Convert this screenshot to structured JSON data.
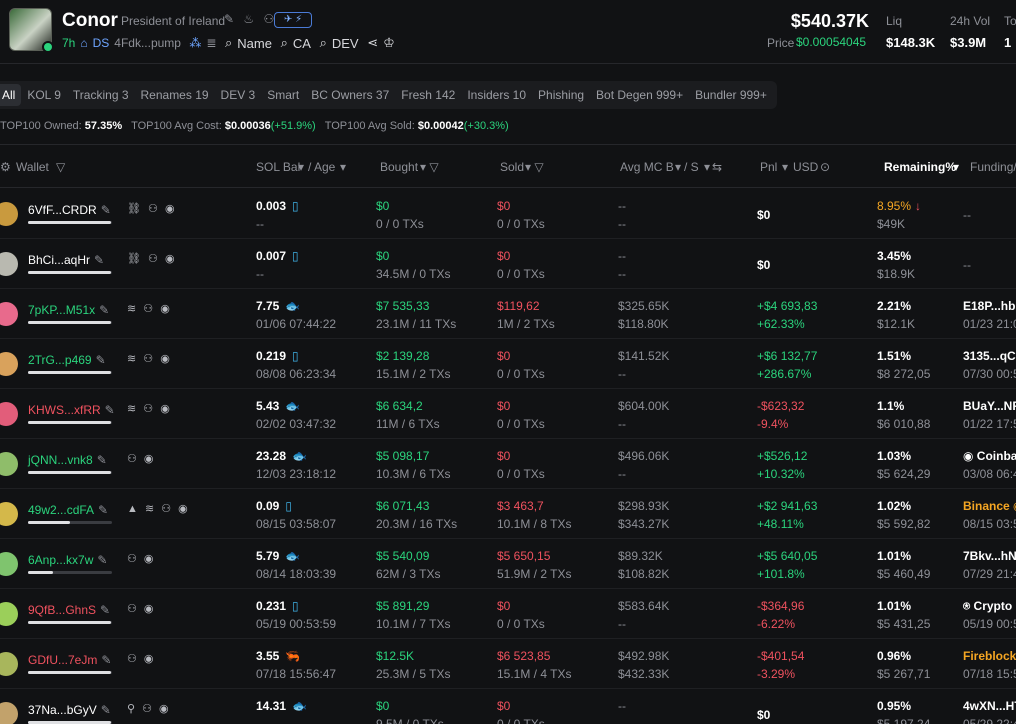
{
  "token": {
    "name": "Conor",
    "description": "President of Ireland",
    "social_badge": "✈ ⚡",
    "age": "7h",
    "dex": "DS",
    "contract_short": "4Fdk...pump",
    "search_name": "Name",
    "search_ca": "CA",
    "search_dev": "DEV",
    "market_cap": "$540.37K",
    "price_label": "Price",
    "price": "$0.00054045",
    "liq_label": "Liq",
    "liq": "$148.3K",
    "vol_label": "24h Vol",
    "vol": "$3.9M",
    "extra_label": "To",
    "extra_value": "1"
  },
  "tabs": [
    "All",
    "KOL 9",
    "Tracking 3",
    "Renames 19",
    "DEV 3",
    "Smart",
    "BC Owners 37",
    "Fresh 142",
    "Insiders 10",
    "Phishing",
    "Bot Degen 999+",
    "Bundler 999+"
  ],
  "top100": {
    "owned_label": "TOP100 Owned:",
    "owned": "57.35%",
    "avg_cost_label": "TOP100 Avg Cost:",
    "avg_cost": "$0.00036",
    "avg_cost_change": "(+51.9%)",
    "avg_sold_label": "TOP100 Avg Sold:",
    "avg_sold": "$0.00042",
    "avg_sold_change": "(+30.3%)"
  },
  "columns": {
    "wallet": "Wallet",
    "sol_bal": "SOL Bal",
    "age": "/ Age",
    "bought": "Bought",
    "sold": "Sold",
    "avg_mc": "Avg MC B",
    "avg_mc_s": "/ S",
    "pnl": "Pnl",
    "usd": "USD",
    "remaining": "Remaining%",
    "funding": "Funding/"
  },
  "rows": [
    {
      "addr": "6VfF...CRDR",
      "addr_color": "#ffffff",
      "tags": "⛓ ⚇ ◉",
      "bar": 0.99,
      "sol": "0.003",
      "sol_icon": "▯",
      "age": "--",
      "bought": "$0",
      "bought_tx": "0 / 0 TXs",
      "sold": "$0",
      "sold_tx": "0 / 0 TXs",
      "mc_b": "--",
      "mc_s": "--",
      "pnl": "$0",
      "pnl_pct": "",
      "rem": "8.95%",
      "rem_note": "↓",
      "rem_usd": "$49K",
      "fund": "--",
      "fund2": "",
      "avatar": "#c99a3e"
    },
    {
      "addr": "BhCi...aqHr",
      "addr_color": "#ffffff",
      "tags": "⛓ ⚇ ◉",
      "bar": 0.99,
      "sol": "0.007",
      "sol_icon": "▯",
      "age": "--",
      "bought": "$0",
      "bought_tx": "34.5M / 0 TXs",
      "sold": "$0",
      "sold_tx": "0 / 0 TXs",
      "mc_b": "--",
      "mc_s": "--",
      "pnl": "$0",
      "pnl_pct": "",
      "rem": "3.45%",
      "rem_note": "",
      "rem_usd": "$18.9K",
      "fund": "--",
      "fund2": "",
      "avatar": "#b9b9b0"
    },
    {
      "addr": "7pKP...M51x",
      "addr_color": "#2bd47d",
      "tags": "≋ ⚇ ◉",
      "bar": 0.99,
      "sol": "7.75",
      "sol_icon": "🐟",
      "age": "01/06 07:44:22",
      "bought": "$7 535,33",
      "bought_tx": "23.1M / 11 TXs",
      "sold": "$119,62",
      "sold_tx": "1M / 2 TXs",
      "mc_b": "$325.65K",
      "mc_s": "$118.80K",
      "pnl": "+$4 693,83",
      "pnl_pct": "+62.33%",
      "rem": "2.21%",
      "rem_note": "",
      "rem_usd": "$12.1K",
      "fund": "E18P...hbq",
      "fund2": "01/23 21:0",
      "avatar": "#e86a8c"
    },
    {
      "addr": "2TrG...p469",
      "addr_color": "#2bd47d",
      "tags": "≋ ⚇ ◉",
      "bar": 0.99,
      "sol": "0.219",
      "sol_icon": "▯",
      "age": "08/08 06:23:34",
      "bought": "$2 139,28",
      "bought_tx": "15.1M / 2 TXs",
      "sold": "$0",
      "sold_tx": "0 / 0 TXs",
      "mc_b": "$141.52K",
      "mc_s": "--",
      "pnl": "+$6 132,77",
      "pnl_pct": "+286.67%",
      "rem": "1.51%",
      "rem_note": "",
      "rem_usd": "$8 272,05",
      "fund": "3135...qCg",
      "fund2": "07/30 00:5",
      "avatar": "#d9a25c"
    },
    {
      "addr": "KHWS...xfRR",
      "addr_color": "#f0525f",
      "tags": "≋ ⚇ ◉",
      "bar": 0.99,
      "sol": "5.43",
      "sol_icon": "🐟",
      "age": "02/02 03:47:32",
      "bought": "$6 634,2",
      "bought_tx": "11M / 6 TXs",
      "sold": "$0",
      "sold_tx": "0 / 0 TXs",
      "mc_b": "$604.00K",
      "mc_s": "--",
      "pnl": "-$623,32",
      "pnl_pct": "-9.4%",
      "rem": "1.1%",
      "rem_note": "",
      "rem_usd": "$6 010,88",
      "fund": "BUaY...NR",
      "fund2": "01/22 17:5",
      "avatar": "#e25d7a"
    },
    {
      "addr": "jQNN...vnk8",
      "addr_color": "#2bd47d",
      "tags": "⚇ ◉",
      "bar": 0.99,
      "sol": "23.28",
      "sol_icon": "🐟",
      "age": "12/03 23:18:12",
      "bought": "$5 098,17",
      "bought_tx": "10.3M / 6 TXs",
      "sold": "$0",
      "sold_tx": "0 / 0 TXs",
      "mc_b": "$496.06K",
      "mc_s": "--",
      "pnl": "+$526,12",
      "pnl_pct": "+10.32%",
      "rem": "1.03%",
      "rem_note": "",
      "rem_usd": "$5 624,29",
      "fund": "◉ Coinba",
      "fund2": "03/08 06:4",
      "avatar": "#8fbd6a"
    },
    {
      "addr": "49w2...cdFA",
      "addr_color": "#2bd47d",
      "tags": "▲ ≋ ⚇ ◉",
      "bar": 0.5,
      "sol": "0.09",
      "sol_icon": "▯",
      "age": "08/15 03:58:07",
      "bought": "$6 071,43",
      "bought_tx": "20.3M / 16 TXs",
      "sold": "$3 463,7",
      "sold_tx": "10.1M / 8 TXs",
      "mc_b": "$298.93K",
      "mc_s": "$343.27K",
      "pnl": "+$2 941,63",
      "pnl_pct": "+48.11%",
      "rem": "1.02%",
      "rem_note": "",
      "rem_usd": "$5 592,82",
      "fund": "Binance ◉",
      "fund2": "08/15 03:5",
      "avatar": "#d4b84a"
    },
    {
      "addr": "6Anp...kx7w",
      "addr_color": "#2bd47d",
      "tags": "⚇ ◉",
      "bar": 0.3,
      "sol": "5.79",
      "sol_icon": "🐟",
      "age": "08/14 18:03:39",
      "bought": "$5 540,09",
      "bought_tx": "62M / 3 TXs",
      "sold": "$5 650,15",
      "sold_tx": "51.9M / 2 TXs",
      "mc_b": "$89.32K",
      "mc_s": "$108.82K",
      "pnl": "+$5 640,05",
      "pnl_pct": "+101.8%",
      "rem": "1.01%",
      "rem_note": "",
      "rem_usd": "$5 460,49",
      "fund": "7Bkv...hNJ",
      "fund2": "07/29 21:4",
      "avatar": "#7fc46e"
    },
    {
      "addr": "9QfB...GhnS",
      "addr_color": "#f0525f",
      "tags": "⚇ ◉",
      "bar": 0.99,
      "sol": "0.231",
      "sol_icon": "▯",
      "age": "05/19 00:53:59",
      "bought": "$5 891,29",
      "bought_tx": "10.1M / 7 TXs",
      "sold": "$0",
      "sold_tx": "0 / 0 TXs",
      "mc_b": "$583.64K",
      "mc_s": "--",
      "pnl": "-$364,96",
      "pnl_pct": "-6.22%",
      "rem": "1.01%",
      "rem_note": "",
      "rem_usd": "$5 431,25",
      "fund": "⍟ Crypto",
      "fund2": "05/19 00:5",
      "avatar": "#9bcf5a"
    },
    {
      "addr": "GDfU...7eJm",
      "addr_color": "#f0525f",
      "tags": "⚇ ◉",
      "bar": 0.99,
      "sol": "3.55",
      "sol_icon": "🦐",
      "age": "07/18 15:56:47",
      "bought": "$12.5K",
      "bought_tx": "25.3M / 5 TXs",
      "sold": "$6 523,85",
      "sold_tx": "15.1M / 4 TXs",
      "mc_b": "$492.98K",
      "mc_s": "$432.33K",
      "pnl": "-$401,54",
      "pnl_pct": "-3.29%",
      "rem": "0.96%",
      "rem_note": "",
      "rem_usd": "$5 267,71",
      "fund": "Fireblocks",
      "fund2": "07/18 15:5",
      "avatar": "#a8b65c"
    },
    {
      "addr": "37Na...bGyV",
      "addr_color": "#ffffff",
      "tags": "⚲ ⚇ ◉",
      "bar": 0.99,
      "sol": "14.31",
      "sol_icon": "🐟",
      "age": "--",
      "bought": "$0",
      "bought_tx": "9.5M / 0 TXs",
      "sold": "$0",
      "sold_tx": "0 / 0 TXs",
      "mc_b": "--",
      "mc_s": "--",
      "pnl": "$0",
      "pnl_pct": "",
      "rem": "0.95%",
      "rem_note": "",
      "rem_usd": "$5 197,24",
      "fund": "4wXN...HT",
      "fund2": "05/29 22:4",
      "avatar": "#c2a26b"
    }
  ]
}
